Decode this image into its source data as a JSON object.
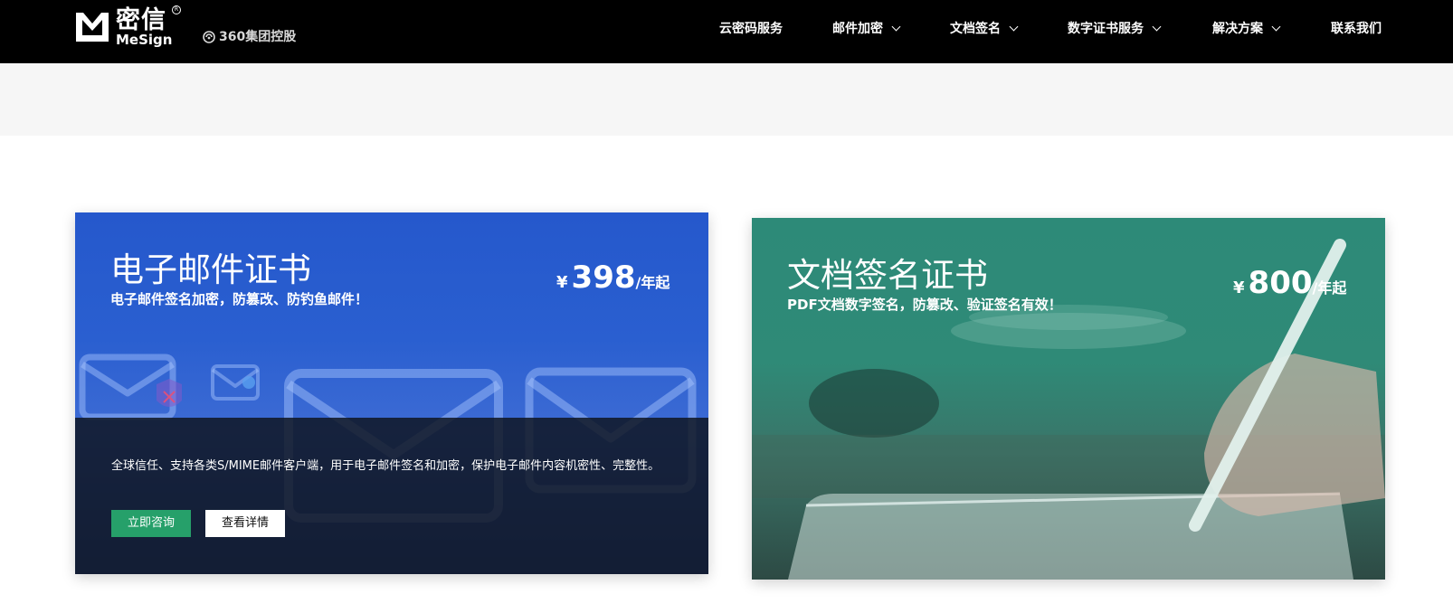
{
  "brand": {
    "name_cn": "密信",
    "name_en": "MeSign",
    "reg_mark": "R",
    "group_text": "360集团控股"
  },
  "nav": {
    "items": [
      {
        "label": "云密码服务",
        "dropdown": false
      },
      {
        "label": "邮件加密",
        "dropdown": true
      },
      {
        "label": "文档签名",
        "dropdown": true
      },
      {
        "label": "数字证书服务",
        "dropdown": true
      },
      {
        "label": "解决方案",
        "dropdown": true
      },
      {
        "label": "联系我们",
        "dropdown": false
      }
    ]
  },
  "cards": [
    {
      "title": "电子邮件证书",
      "subtitle": "电子邮件签名加密，防篡改、防钓鱼邮件！",
      "price_currency": "¥",
      "price_value": "398",
      "price_unit": "/年起",
      "description": "全球信任、支持各类S/MIME邮件客户端，用于电子邮件签名和加密，保护电子邮件内容机密性、完整性。",
      "buttons": {
        "consult": "立即咨询",
        "details": "查看详情"
      },
      "accent": "#2a5fd0"
    },
    {
      "title": "文档签名证书",
      "subtitle": "PDF文档数字签名，防篡改、验证签名有效！",
      "price_currency": "¥",
      "price_value": "800",
      "price_unit": "/年起",
      "accent": "#2f8a77"
    }
  ],
  "colors": {
    "topbar": "#000000",
    "strip": "#f6f6f6",
    "button_primary": "#26a06a"
  }
}
